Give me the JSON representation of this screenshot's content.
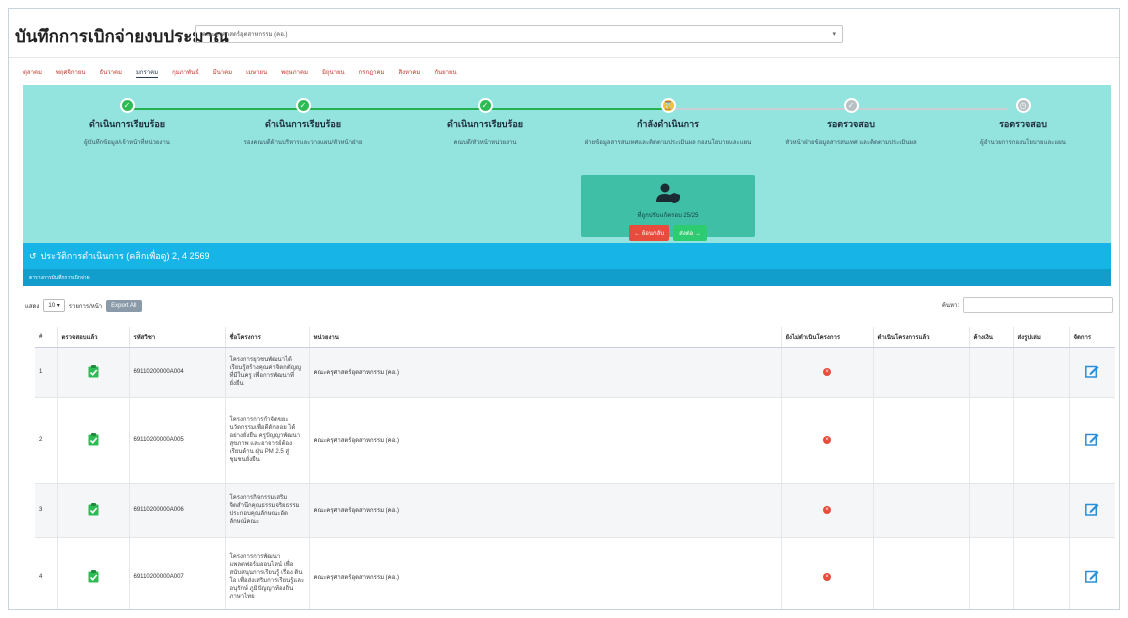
{
  "header": {
    "title": "บันทึกการเบิกจ่ายงบประมาณ",
    "org_select": "คณะครุศาสตร์อุตสาหกรรม (คอ.)"
  },
  "month_tabs": [
    "ตุลาคม",
    "พฤศจิกายน",
    "ธันวาคม",
    "มกราคม",
    "กุมภาพันธ์",
    "มีนาคม",
    "เมษายน",
    "พฤษภาคม",
    "มิถุนายน",
    "กรกฎาคม",
    "สิงหาคม",
    "กันยายน"
  ],
  "active_month_index": 3,
  "workflow": {
    "steps": [
      {
        "title": "ดำเนินการเรียบร้อย",
        "subtitle": "ผู้บันทึกข้อมูล/เจ้าหน้าที่หน่วยงาน",
        "status": "done"
      },
      {
        "title": "ดำเนินการเรียบร้อย",
        "subtitle": "รองคณบดีด้านบริหารและวางแผน/หัวหน้าฝ่าย",
        "status": "done"
      },
      {
        "title": "ดำเนินการเรียบร้อย",
        "subtitle": "คณบดี/หัวหน้าหน่วยงาน",
        "status": "done"
      },
      {
        "title": "กำลังดำเนินการ",
        "subtitle": "ฝ่ายข้อมูลสารสนเทศและติดตามประเมินผล กองนโยบายและแผน",
        "status": "current"
      },
      {
        "title": "รอตรวจสอบ",
        "subtitle": "หัวหน้าฝ่ายข้อมูลสารสนเทศ และติดตามประเมินผล",
        "status": "pending"
      },
      {
        "title": "รอตรวจสอบ",
        "subtitle": "ผู้อำนวยการกองนโยบายและแผน",
        "status": "pending"
      }
    ],
    "current_box": {
      "count_text": "ที่ถูกปรับแก้ครอบ 25/25",
      "back_label": "← ย้อนกลับ",
      "next_label": "ส่งต่อ →"
    }
  },
  "history_bar": {
    "icon": "history-icon",
    "text": "ประวัติการดำเนินการ (คลิกเพื่อดู) 2, 4 2569"
  },
  "subbar_text": "ตารางการบันทึกการเบิกจ่าย",
  "controls": {
    "show_label": "แสดง",
    "page_size": "10",
    "records_label": "รายการ/หน้า",
    "export_label": "Export All",
    "search_label": "ค้นหา:"
  },
  "table": {
    "headers": [
      "#",
      "ตรวจสอบแล้ว",
      "รหัสวิชา",
      "ชื่อโครงการ",
      "หน่วยงาน",
      "ยังไม่ดำเนินโครงการ",
      "ดำเนินโครงการแล้ว",
      "ค้างเงิน",
      "ส่งรูปเล่ม",
      "จัดการ"
    ],
    "rows": [
      {
        "no": "1",
        "code": "69110200000A004",
        "name": "โครงการยุวชนพัฒนาได้เรียนรู้สร้างคุณค่าจิตกตัญญูที่มีในครู เพื่อการพัฒนาที่ยั่งยืน",
        "unit": "คณะครุศาสตร์อุตสาหกรรม (คอ.)"
      },
      {
        "no": "2",
        "code": "69110200000A005",
        "name": "โครงการการกำจัดขยะ นวัตกรรมเพื่อดีดักลอย ได้อย่างยั่งยืน ครูปัญญาพัฒนาสุขภาพ และอาจารย์ต้องเรียนด้าน ฝุ่น PM 2.5 สู่ชุมชนยั่งยืน",
        "unit": "คณะครุศาสตร์อุตสาหกรรม (คอ.)"
      },
      {
        "no": "3",
        "code": "69110200000A006",
        "name": "โครงการกิจกรรมเสริมจิตสำนึกคุณธรรมจริยธรรม ประกอบคุณลักษณะอัตลักษณ์คณะ",
        "unit": "คณะครุศาสตร์อุตสาหกรรม (คอ.)"
      },
      {
        "no": "4",
        "code": "69110200000A007",
        "name": "โครงการการพัฒนาแพลตฟอร์มออนไลน์ เพื่อสนับสนุนการเรียนรู้ เรื่อง ดินโอ เพื่อส่งเสริมการเรียนรู้และอนุรักษ์ ภูมิปัญญาท้องถิ่น ภาษาไทย",
        "unit": "คณะครุศาสตร์อุตสาหกรรม (คอ.)"
      }
    ]
  }
}
